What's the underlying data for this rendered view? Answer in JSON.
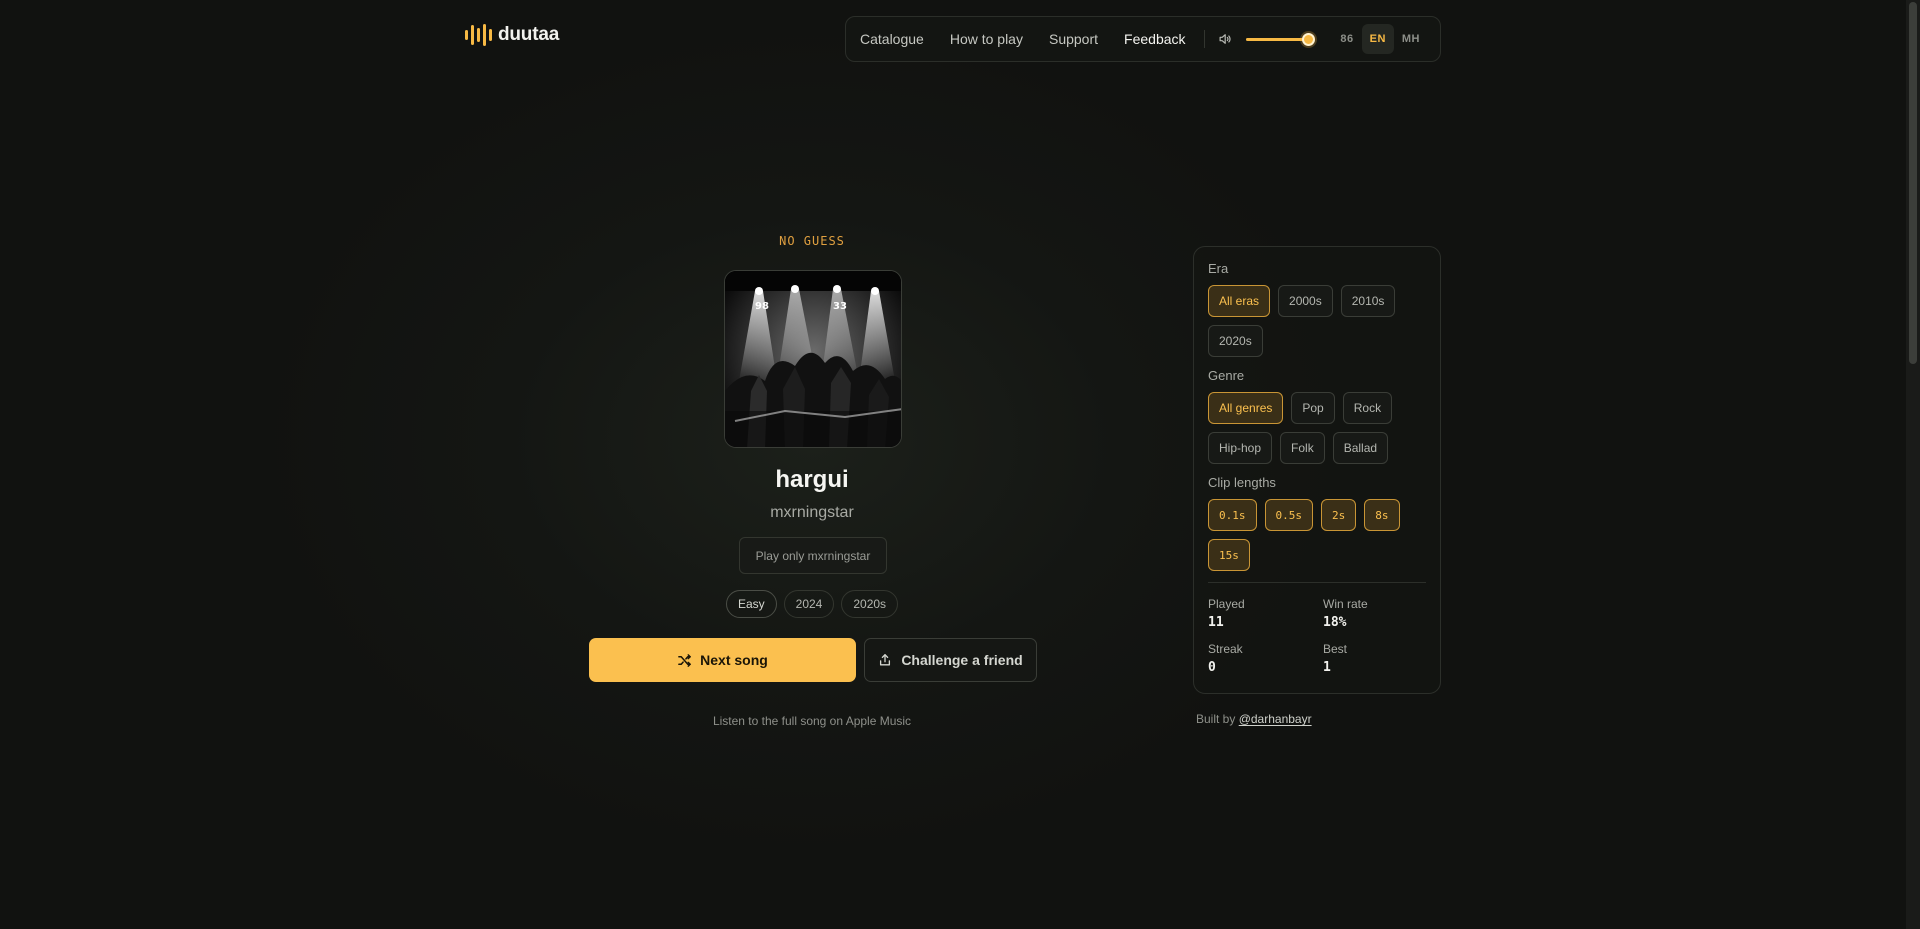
{
  "brand": {
    "name": "duutaa",
    "accent": "#f7b944"
  },
  "nav": {
    "links": [
      "Catalogue",
      "How to play",
      "Support",
      "Feedback"
    ],
    "active": "Feedback",
    "volume": 0.82,
    "languages": [
      "86",
      "EN",
      "MH"
    ],
    "active_language": "EN"
  },
  "game": {
    "status": "NO GUESS",
    "song_title": "hargui",
    "artist": "mxrningstar",
    "play_only_label": "Play only mxrningstar",
    "tags": [
      "Easy",
      "2024",
      "2020s"
    ],
    "next_label": "Next song",
    "challenge_label": "Challenge a friend",
    "listen_link": "Listen to the full song on Apple Music"
  },
  "filters": {
    "era_label": "Era",
    "eras": [
      {
        "label": "All eras",
        "on": true
      },
      {
        "label": "2000s",
        "on": false
      },
      {
        "label": "2010s",
        "on": false
      },
      {
        "label": "2020s",
        "on": false
      }
    ],
    "genre_label": "Genre",
    "genres": [
      {
        "label": "All genres",
        "on": true
      },
      {
        "label": "Pop",
        "on": false
      },
      {
        "label": "Rock",
        "on": false
      },
      {
        "label": "Hip-hop",
        "on": false
      },
      {
        "label": "Folk",
        "on": false
      },
      {
        "label": "Ballad",
        "on": false
      }
    ],
    "clip_label": "Clip lengths",
    "clips": [
      {
        "label": "0.1s",
        "on": true
      },
      {
        "label": "0.5s",
        "on": true
      },
      {
        "label": "2s",
        "on": true
      },
      {
        "label": "8s",
        "on": true
      },
      {
        "label": "15s",
        "on": true
      }
    ]
  },
  "stats": {
    "played_label": "Played",
    "played": "11",
    "winrate_label": "Win rate",
    "winrate": "18%",
    "streak_label": "Streak",
    "streak": "0",
    "best_label": "Best",
    "best": "1"
  },
  "footer": {
    "built_prefix": "Built by",
    "built_handle": "@darhanbayr"
  }
}
